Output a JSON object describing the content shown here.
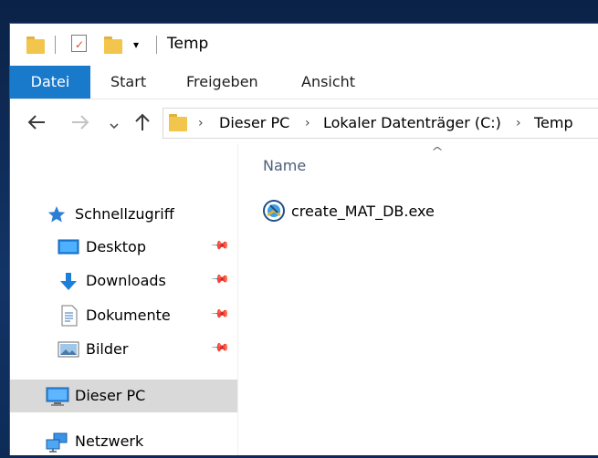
{
  "window": {
    "title": "Temp",
    "qat_icons": [
      "folder-icon",
      "properties-icon",
      "new-folder-icon",
      "dropdown-arrow-icon"
    ]
  },
  "ribbon": {
    "tabs": [
      {
        "label": "Datei",
        "active": true
      },
      {
        "label": "Start"
      },
      {
        "label": "Freigeben"
      },
      {
        "label": "Ansicht"
      }
    ]
  },
  "nav": {
    "back_icon": "arrow-left-icon",
    "forward_icon": "arrow-right-icon",
    "recent_icon": "chevron-down-icon",
    "up_icon": "arrow-up-icon",
    "breadcrumb": [
      "Dieser PC",
      "Lokaler Datenträger (C:)",
      "Temp"
    ]
  },
  "sidebar": {
    "quick_access": "Schnellzugriff",
    "items": [
      {
        "label": "Desktop",
        "pinned": true
      },
      {
        "label": "Downloads",
        "pinned": true
      },
      {
        "label": "Dokumente",
        "pinned": true
      },
      {
        "label": "Bilder",
        "pinned": true
      }
    ],
    "this_pc": "Dieser PC",
    "network": "Netzwerk"
  },
  "content": {
    "column_name": "Name",
    "files": [
      {
        "name": "create_MAT_DB.exe"
      }
    ]
  },
  "colors": {
    "accent": "#1979ca",
    "selected": "#d9d9d9",
    "folder": "#f2c54c"
  }
}
